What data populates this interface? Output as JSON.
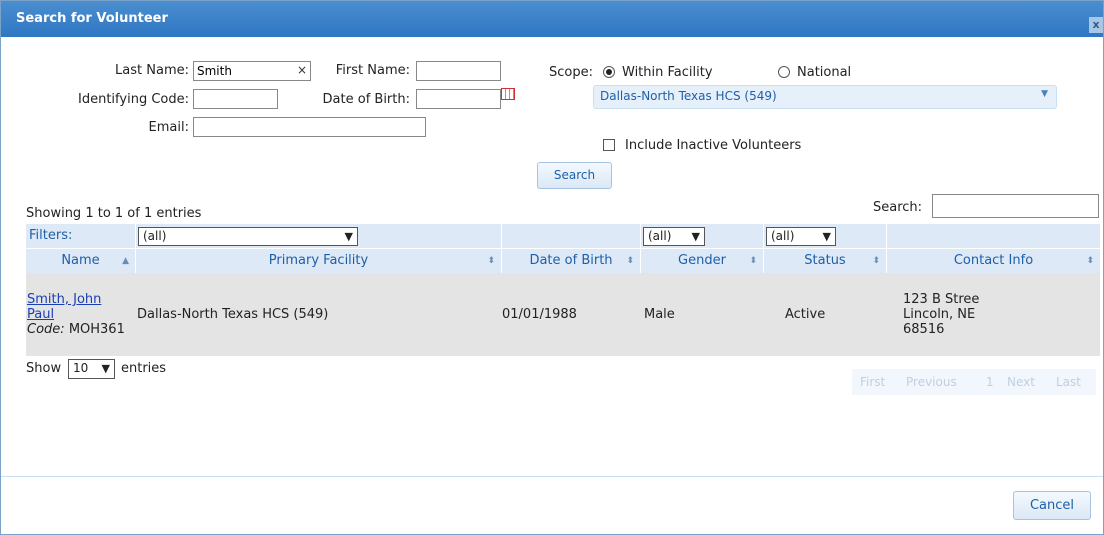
{
  "dialog": {
    "title": "Search for Volunteer",
    "close_label": "x"
  },
  "form": {
    "last_name_label": "Last Name:",
    "last_name_value": "Smith",
    "clear_label": "×",
    "first_name_label": "First Name:",
    "first_name_value": "",
    "identifying_code_label": "Identifying Code:",
    "identifying_code_value": "",
    "dob_label": "Date of Birth:",
    "dob_value": "",
    "email_label": "Email:",
    "email_value": "",
    "scope_label": "Scope:",
    "scope_within_label": "Within Facility",
    "scope_national_label": "National",
    "scope_selected": "Within Facility",
    "facility_value": "Dallas-North Texas HCS (549)",
    "include_inactive_label": "Include Inactive Volunteers",
    "include_inactive_checked": false,
    "search_button": "Search"
  },
  "table": {
    "info": "Showing 1 to 1 of 1 entries",
    "search_label": "Search:",
    "search_value": "",
    "filters_label": "Filters:",
    "facility_filter": "(all)",
    "gender_filter": "(all)",
    "status_filter": "(all)",
    "columns": [
      "Name",
      "Primary Facility",
      "Date of Birth",
      "Gender",
      "Status",
      "Contact Info"
    ],
    "rows": [
      {
        "name_line1": "Smith, John",
        "name_line2": "Paul",
        "code_label": "Code:",
        "code_value": "MOH361",
        "facility": "Dallas-North Texas HCS (549)",
        "dob": "01/01/1988",
        "gender": "Male",
        "status": "Active",
        "contact_line1": "123 B Stree",
        "contact_line2": "Lincoln, NE",
        "contact_line3": "68516"
      }
    ],
    "length_show": "Show",
    "length_value": "10",
    "length_entries": "entries",
    "pager": {
      "first": "First",
      "previous": "Previous",
      "page": "1",
      "next": "Next",
      "last": "Last"
    }
  },
  "footer": {
    "cancel_button": "Cancel"
  },
  "colors": {
    "title_bar": "#2f77c3",
    "header_bg": "#dde9f6",
    "row_bg": "#e4e4e4",
    "link": "#1a3fb5"
  }
}
